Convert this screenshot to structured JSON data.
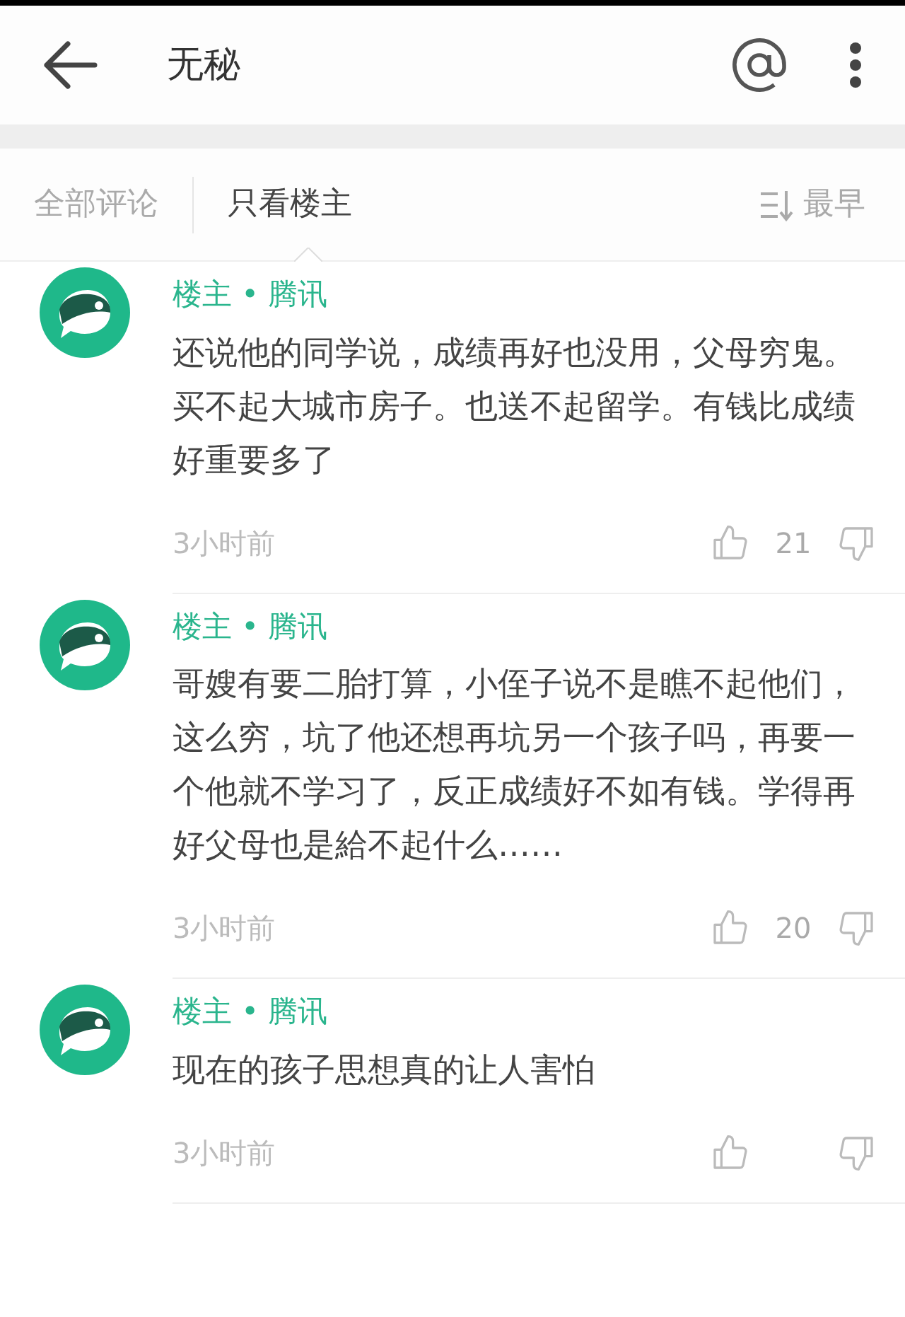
{
  "header": {
    "title": "无秘"
  },
  "tabs": [
    {
      "label": "全部评论",
      "selected": false
    },
    {
      "label": "只看楼主",
      "selected": true
    }
  ],
  "sort": {
    "label": "最早"
  },
  "comments": [
    {
      "author": "楼主 • 腾讯",
      "text": "还说他的同学说，成绩再好也没用，父母穷鬼。买不起大城市房子。也送不起留学。有钱比成绩好重要多了",
      "time": "3小时前",
      "likes": "21"
    },
    {
      "author": "楼主 • 腾讯",
      "text": "哥嫂有要二胎打算，小侄子说不是瞧不起他们，这么穷，坑了他还想再坑另一个孩子吗，再要一个他就不学习了，反正成绩好不如有钱。学得再好父母也是給不起什么……",
      "time": "3小时前",
      "likes": "20"
    },
    {
      "author": "楼主 • 腾讯",
      "text": "现在的孩子思想真的让人害怕",
      "time": "3小时前"
    }
  ]
}
